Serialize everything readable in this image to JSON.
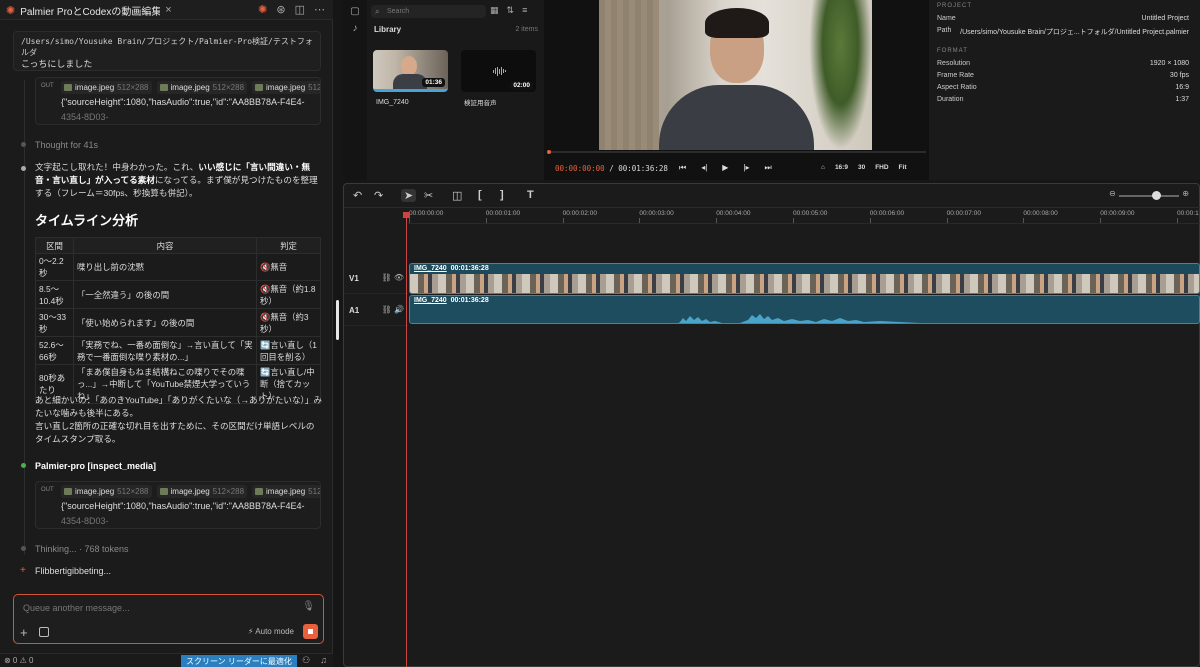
{
  "chat": {
    "tab_title": "Palmier ProとCodexの動画編集デモ...",
    "path_line": "/Users/simo/Yousuke Brain/プロジェクト/Palmier-Pro検証/テストフォルダ",
    "user_reply": "こっちにしました",
    "out_label": "OUT",
    "image_chips": [
      {
        "name": "image.jpeg",
        "dim": "512×288"
      },
      {
        "name": "image.jpeg",
        "dim": "512×288"
      },
      {
        "name": "image.jpeg",
        "dim": "512×28"
      }
    ],
    "json_line": "{\"sourceHeight\":1080,\"hasAudio\":true,\"id\":\"AA8BB78A-F4E4-",
    "json_line2": "4354-8D03-",
    "thought": "Thought for 41s",
    "message_a": "文字起こし取れた！中身わかった。これ、",
    "message_b": "いい感じに「言い間違い・無音・言い直し」が入ってる素材",
    "message_c": "になってる。まず僕が見つけたものを整理する（フレーム＝30fps、秒換算も併記）。",
    "heading": "タイムライン分析",
    "table_headers": [
      "区間",
      "内容",
      "判定"
    ],
    "rows": [
      {
        "range": "0〜2.2秒",
        "content": "喋り出し前の沈黙",
        "verdict": "🔇無音"
      },
      {
        "range": "8.5〜10.4秒",
        "content": "「一全然違う」の後の間",
        "verdict": "🔇無音（約1.8秒）"
      },
      {
        "range": "30〜33秒",
        "content": "「使い始められます」の後の間",
        "verdict": "🔇無音（約3秒）"
      },
      {
        "range": "52.6〜66秒",
        "content": "「実務でね、一番め面倒な」→言い直して「実務で一番面倒な喋り素材の...」",
        "verdict": "🔄言い直し（1回目を削る）"
      },
      {
        "range": "80秒あたり",
        "content": "「まあ僕自身もねま結構ねこの喋りでその喋っ...」→中断して「YouTube禁煙大学っていうね」",
        "verdict": "🔄言い直し/中断（捨てカット）"
      }
    ],
    "after_a": "あと細かいの：「あのきYouTube」「ありがくたいな（→ありがたいな）」みたいな噛みも後半にある。",
    "after_b": "言い直し2箇所の正確な切れ目を出すために、その区間だけ単語レベルのタイムスタンプ取る。",
    "tool_call": "Palmier-pro [inspect_media]",
    "thinking": "Thinking... · 768 tokens",
    "flibber": "Flibbertigibbeting...",
    "composer_placeholder": "Queue another message...",
    "auto_mode": "Auto mode",
    "status_left": "⊗ 0 ⚠ 0",
    "screen_reader": "スクリーン リーダーに最適化"
  },
  "media": {
    "search_placeholder": "Search",
    "library_label": "Library",
    "items_count": "2 items",
    "clips": [
      {
        "name": "IMG_7240",
        "duration": "01:36"
      },
      {
        "name": "検証用音声",
        "duration": "02:00"
      }
    ]
  },
  "viewer": {
    "current_tc": "00:00:00:00",
    "sep": "/",
    "total_tc": "00:01:36:28",
    "playhead_fraction": 0.0,
    "aspect": "16:9",
    "fps": "30",
    "quality": "FHD",
    "fit": "Fit"
  },
  "inspector": {
    "project_label": "PROJECT",
    "name_key": "Name",
    "name_val": "Untitled Project",
    "path_key": "Path",
    "path_val": "/Users/simo/Yousuke Brain/プロジェ...トフォルダ/Untitled Project.palmier",
    "format_label": "FORMAT",
    "res_key": "Resolution",
    "res_val": "1920 × 1080",
    "fr_key": "Frame Rate",
    "fr_val": "30 fps",
    "ar_key": "Aspect Ratio",
    "ar_val": "16:9",
    "dur_key": "Duration",
    "dur_val": "1:37"
  },
  "timeline": {
    "ruler": [
      "00:00:00:00",
      "00:00:01:00",
      "00:00:02:00",
      "00:00:03:00",
      "00:00:04:00",
      "00:00:05:00",
      "00:00:06:00",
      "00:00:07:00",
      "00:00:08:00",
      "00:00:09:00",
      "00:00:1"
    ],
    "v1": "V1",
    "a1": "A1",
    "clip_name": "IMG_7240",
    "clip_tc": "00:01:36:28",
    "zoom_level": 0.62
  }
}
